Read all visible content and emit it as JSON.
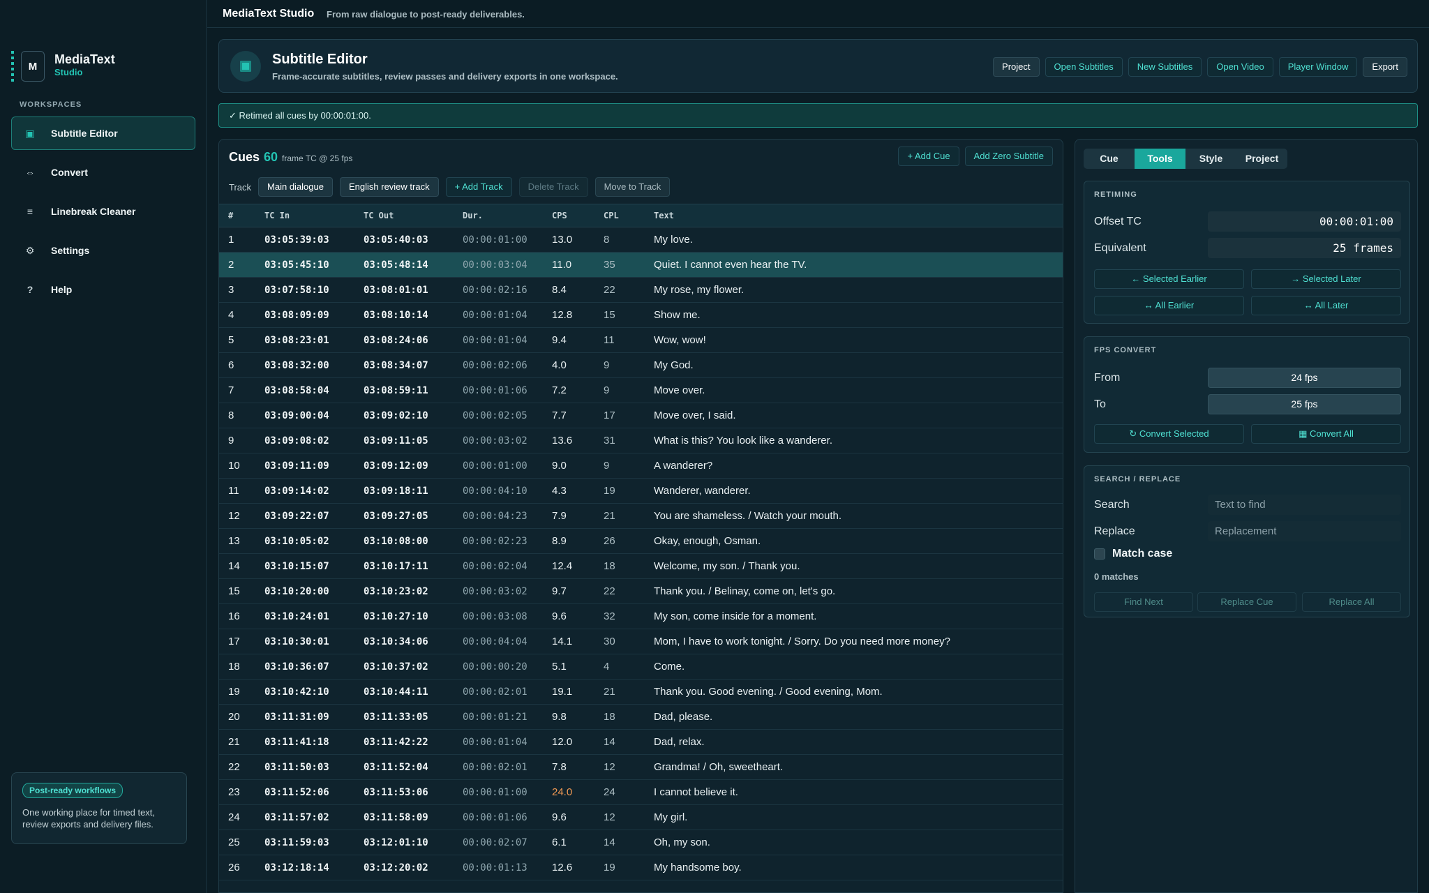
{
  "app": {
    "name": "MediaText Studio",
    "tagline": "From raw dialogue to post-ready deliverables."
  },
  "brand": {
    "logo_letter": "M",
    "name": "MediaText",
    "sub": "Studio"
  },
  "sidebar": {
    "section_label": "WORKSPACES",
    "items": [
      {
        "label": "Subtitle Editor",
        "icon": "subtitle-editor-icon",
        "glyph": "▣",
        "active": true
      },
      {
        "label": "Convert",
        "icon": "convert-icon",
        "glyph": "⇔",
        "active": false
      },
      {
        "label": "Linebreak Cleaner",
        "icon": "lines-icon",
        "glyph": "≡",
        "active": false
      },
      {
        "label": "Settings",
        "icon": "gear-icon",
        "glyph": "⚙",
        "active": false
      },
      {
        "label": "Help",
        "icon": "help-icon",
        "glyph": "?",
        "active": false
      }
    ],
    "promo": {
      "badge": "Post-ready workflows",
      "text": "One working place for timed text, review exports and delivery files."
    }
  },
  "header": {
    "title": "Subtitle Editor",
    "subtitle": "Frame-accurate subtitles, review passes and delivery exports in one workspace.",
    "buttons": {
      "project": "Project",
      "open_subtitles": "Open Subtitles",
      "new_subtitles": "New Subtitles",
      "open_video": "Open Video",
      "player_window": "Player Window",
      "export": "Export"
    }
  },
  "notice": "✓ Retimed all cues by 00:00:01:00.",
  "cues": {
    "title": "Cues",
    "count": "60",
    "meta": "frame TC @ 25 fps",
    "add_cue": "+ Add Cue",
    "add_zero": "Add Zero Subtitle",
    "track_label": "Track",
    "tracks": {
      "main": "Main dialogue",
      "review": "English review track",
      "add": "+ Add Track",
      "delete": "Delete Track",
      "move": "Move to Track"
    },
    "columns": {
      "num": "#",
      "tc_in": "TC In",
      "tc_out": "TC Out",
      "dur": "Dur.",
      "cps": "CPS",
      "cpl": "CPL",
      "text": "Text"
    },
    "selected_row": 2,
    "rows": [
      {
        "n": "1",
        "in": "03:05:39:03",
        "out": "03:05:40:03",
        "dur": "00:00:01:00",
        "cps": "13.0",
        "cpl": "8",
        "text": "My love."
      },
      {
        "n": "2",
        "in": "03:05:45:10",
        "out": "03:05:48:14",
        "dur": "00:00:03:04",
        "cps": "11.0",
        "cpl": "35",
        "text": "Quiet. I cannot even hear the TV."
      },
      {
        "n": "3",
        "in": "03:07:58:10",
        "out": "03:08:01:01",
        "dur": "00:00:02:16",
        "cps": "8.4",
        "cpl": "22",
        "text": "My rose, my flower."
      },
      {
        "n": "4",
        "in": "03:08:09:09",
        "out": "03:08:10:14",
        "dur": "00:00:01:04",
        "cps": "12.8",
        "cpl": "15",
        "text": "Show me."
      },
      {
        "n": "5",
        "in": "03:08:23:01",
        "out": "03:08:24:06",
        "dur": "00:00:01:04",
        "cps": "9.4",
        "cpl": "11",
        "text": "Wow, wow!"
      },
      {
        "n": "6",
        "in": "03:08:32:00",
        "out": "03:08:34:07",
        "dur": "00:00:02:06",
        "cps": "4.0",
        "cpl": "9",
        "text": "My God."
      },
      {
        "n": "7",
        "in": "03:08:58:04",
        "out": "03:08:59:11",
        "dur": "00:00:01:06",
        "cps": "7.2",
        "cpl": "9",
        "text": "Move over."
      },
      {
        "n": "8",
        "in": "03:09:00:04",
        "out": "03:09:02:10",
        "dur": "00:00:02:05",
        "cps": "7.7",
        "cpl": "17",
        "text": "Move over, I said."
      },
      {
        "n": "9",
        "in": "03:09:08:02",
        "out": "03:09:11:05",
        "dur": "00:00:03:02",
        "cps": "13.6",
        "cpl": "31",
        "text": "What is this? You look like a wanderer."
      },
      {
        "n": "10",
        "in": "03:09:11:09",
        "out": "03:09:12:09",
        "dur": "00:00:01:00",
        "cps": "9.0",
        "cpl": "9",
        "text": "A wanderer?"
      },
      {
        "n": "11",
        "in": "03:09:14:02",
        "out": "03:09:18:11",
        "dur": "00:00:04:10",
        "cps": "4.3",
        "cpl": "19",
        "text": "Wanderer, wanderer."
      },
      {
        "n": "12",
        "in": "03:09:22:07",
        "out": "03:09:27:05",
        "dur": "00:00:04:23",
        "cps": "7.9",
        "cpl": "21",
        "text": "You are shameless. / Watch your mouth."
      },
      {
        "n": "13",
        "in": "03:10:05:02",
        "out": "03:10:08:00",
        "dur": "00:00:02:23",
        "cps": "8.9",
        "cpl": "26",
        "text": "Okay, enough, Osman."
      },
      {
        "n": "14",
        "in": "03:10:15:07",
        "out": "03:10:17:11",
        "dur": "00:00:02:04",
        "cps": "12.4",
        "cpl": "18",
        "text": "Welcome, my son. / Thank you."
      },
      {
        "n": "15",
        "in": "03:10:20:00",
        "out": "03:10:23:02",
        "dur": "00:00:03:02",
        "cps": "9.7",
        "cpl": "22",
        "text": "Thank you. / Belinay, come on, let's go."
      },
      {
        "n": "16",
        "in": "03:10:24:01",
        "out": "03:10:27:10",
        "dur": "00:00:03:08",
        "cps": "9.6",
        "cpl": "32",
        "text": "My son, come inside for a moment."
      },
      {
        "n": "17",
        "in": "03:10:30:01",
        "out": "03:10:34:06",
        "dur": "00:00:04:04",
        "cps": "14.1",
        "cpl": "30",
        "text": "Mom, I have to work tonight. / Sorry. Do you need more money?"
      },
      {
        "n": "18",
        "in": "03:10:36:07",
        "out": "03:10:37:02",
        "dur": "00:00:00:20",
        "cps": "5.1",
        "cpl": "4",
        "text": "Come."
      },
      {
        "n": "19",
        "in": "03:10:42:10",
        "out": "03:10:44:11",
        "dur": "00:00:02:01",
        "cps": "19.1",
        "cpl": "21",
        "text": "Thank you. Good evening. / Good evening, Mom."
      },
      {
        "n": "20",
        "in": "03:11:31:09",
        "out": "03:11:33:05",
        "dur": "00:00:01:21",
        "cps": "9.8",
        "cpl": "18",
        "text": "Dad, please."
      },
      {
        "n": "21",
        "in": "03:11:41:18",
        "out": "03:11:42:22",
        "dur": "00:00:01:04",
        "cps": "12.0",
        "cpl": "14",
        "text": "Dad, relax."
      },
      {
        "n": "22",
        "in": "03:11:50:03",
        "out": "03:11:52:04",
        "dur": "00:00:02:01",
        "cps": "7.8",
        "cpl": "12",
        "text": "Grandma! / Oh, sweetheart."
      },
      {
        "n": "23",
        "in": "03:11:52:06",
        "out": "03:11:53:06",
        "dur": "00:00:01:00",
        "cps": "24.0",
        "cpl": "24",
        "text": "I cannot believe it.",
        "hot": true
      },
      {
        "n": "24",
        "in": "03:11:57:02",
        "out": "03:11:58:09",
        "dur": "00:00:01:06",
        "cps": "9.6",
        "cpl": "12",
        "text": "My girl."
      },
      {
        "n": "25",
        "in": "03:11:59:03",
        "out": "03:12:01:10",
        "dur": "00:00:02:07",
        "cps": "6.1",
        "cpl": "14",
        "text": "Oh, my son."
      },
      {
        "n": "26",
        "in": "03:12:18:14",
        "out": "03:12:20:02",
        "dur": "00:00:01:13",
        "cps": "12.6",
        "cpl": "19",
        "text": "My handsome boy."
      }
    ]
  },
  "tools": {
    "tabs": [
      "Cue",
      "Tools",
      "Style",
      "Project"
    ],
    "active_tab": "Tools",
    "retiming": {
      "title": "RETIMING",
      "offset_label": "Offset TC",
      "offset_value": "00:00:01:00",
      "equiv_label": "Equivalent",
      "equiv_value": "25 frames",
      "selected_earlier": "← Selected Earlier",
      "selected_later": "→ Selected Later",
      "all_earlier": "↔ All Earlier",
      "all_later": "↔ All Later"
    },
    "fps": {
      "title": "FPS CONVERT",
      "from_label": "From",
      "from_value": "24 fps",
      "to_label": "To",
      "to_value": "25 fps",
      "convert_selected": "↻ Convert Selected",
      "convert_all": "▦ Convert All"
    },
    "search": {
      "title": "SEARCH / REPLACE",
      "search_label": "Search",
      "search_placeholder": "Text to find",
      "replace_label": "Replace",
      "replace_placeholder": "Replacement",
      "match_case": "Match case",
      "matches": "0 matches",
      "find_next": "Find Next",
      "replace_cue": "Replace Cue",
      "replace_all": "Replace All"
    }
  },
  "colors": {
    "accent": "#23c3b3",
    "selected_row": "#1b4f55",
    "cps_warning": "#f29a54"
  }
}
